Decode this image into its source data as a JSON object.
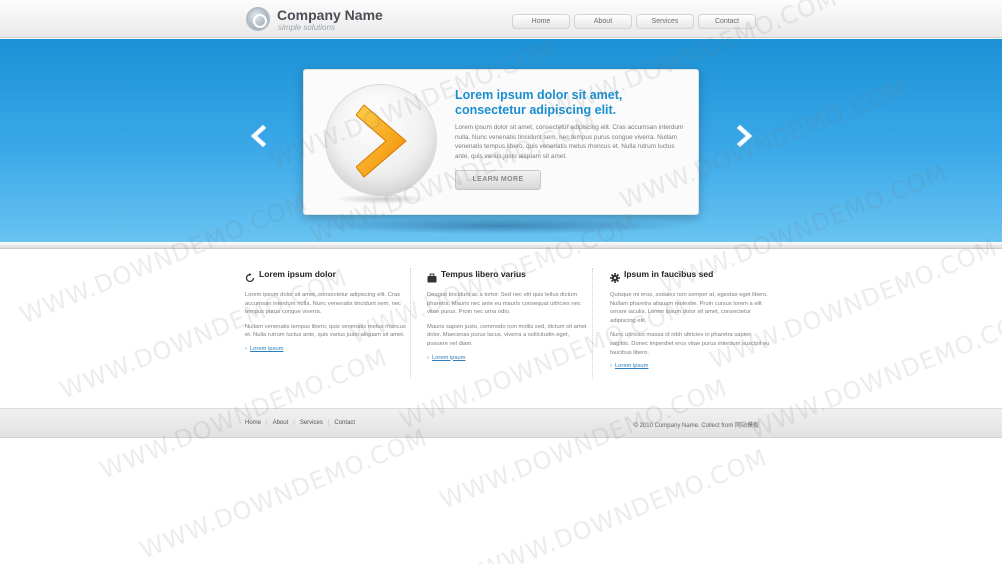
{
  "header": {
    "logo_name": "Company Name",
    "logo_tagline": "simple solutions",
    "nav": [
      "Home",
      "About",
      "Services",
      "Contact"
    ]
  },
  "slider": {
    "title": "Lorem ipsum dolor sit amet, consectetur adipiscing elit.",
    "text": "Lorem ipsum dolor sit amet, consectetur adipiscing elit. Cras accumsan interdum nulla. Nunc venenatis tincidunt sem, nec tempus purus congue viverra. Nullam venenatis tempus libero, quis venenatis metus rhoncus et. Nulla rutrum luctus ante, quis varius justo aliquam sit amet.",
    "button": "LEARN MORE"
  },
  "columns": [
    {
      "icon": "refresh-icon",
      "title": "Lorem ipsum dolor",
      "p1": "Lorem ipsum dolor sit amet, consectetur adipiscing elit. Cras accumsan interdum nulla. Nunc venenatis tincidunt sem, nec tempus purus congue viverra.",
      "p2": "Nullam venenatis tempus libero, quis venenatis metus rhoncus et. Nulla rutrum luctus ante, quis varius justo aliquam sit amet.",
      "link": "Lorem ipsum"
    },
    {
      "icon": "briefcase-icon",
      "title": "Tempus libero varius",
      "p1": "Deugiat tincidunt ac a tortor. Sed nec elit quis tellus dictum pharetra. Mauris nec ante eu mauris consequat ultricies nec vitae purus. Proin nec urna odio.",
      "p2": "Mauris sapien justo, commodo non mollis sed, dictum sit amet dolor. Maecenas purus lacus, viverra a sollicitudin eget, posuere vel diam.",
      "link": "Lorem ipsum"
    },
    {
      "icon": "gear-icon",
      "title": "Ipsum in faucibus sed",
      "p1": "Quisque mi eros, sodales non semper at, egestas eget libero. Nullam pharetra aliquam molestie. Proin cursus lorem a elit ornare iaculis. Lorem ipsum dolor sit amet, consectetur adipiscing elit.",
      "p2": "Nunc ultricies massa id nibh ultricies in pharetra sapien sagittis. Donec imperdiet eros vitae purus interdum suscipit eu faucibus libero.",
      "link": "Lorem ipsum"
    }
  ],
  "footer": {
    "nav": [
      "Home",
      "About",
      "Services",
      "Contact"
    ],
    "copyright": "© 2010 Company Name. Collect from 网站模板"
  },
  "watermark": "WWW.DOWNDEMO.COM",
  "colors": {
    "hero_blue": "#2a9ee0",
    "title_blue": "#1a8fd0",
    "accent_orange": "#f5a623"
  }
}
